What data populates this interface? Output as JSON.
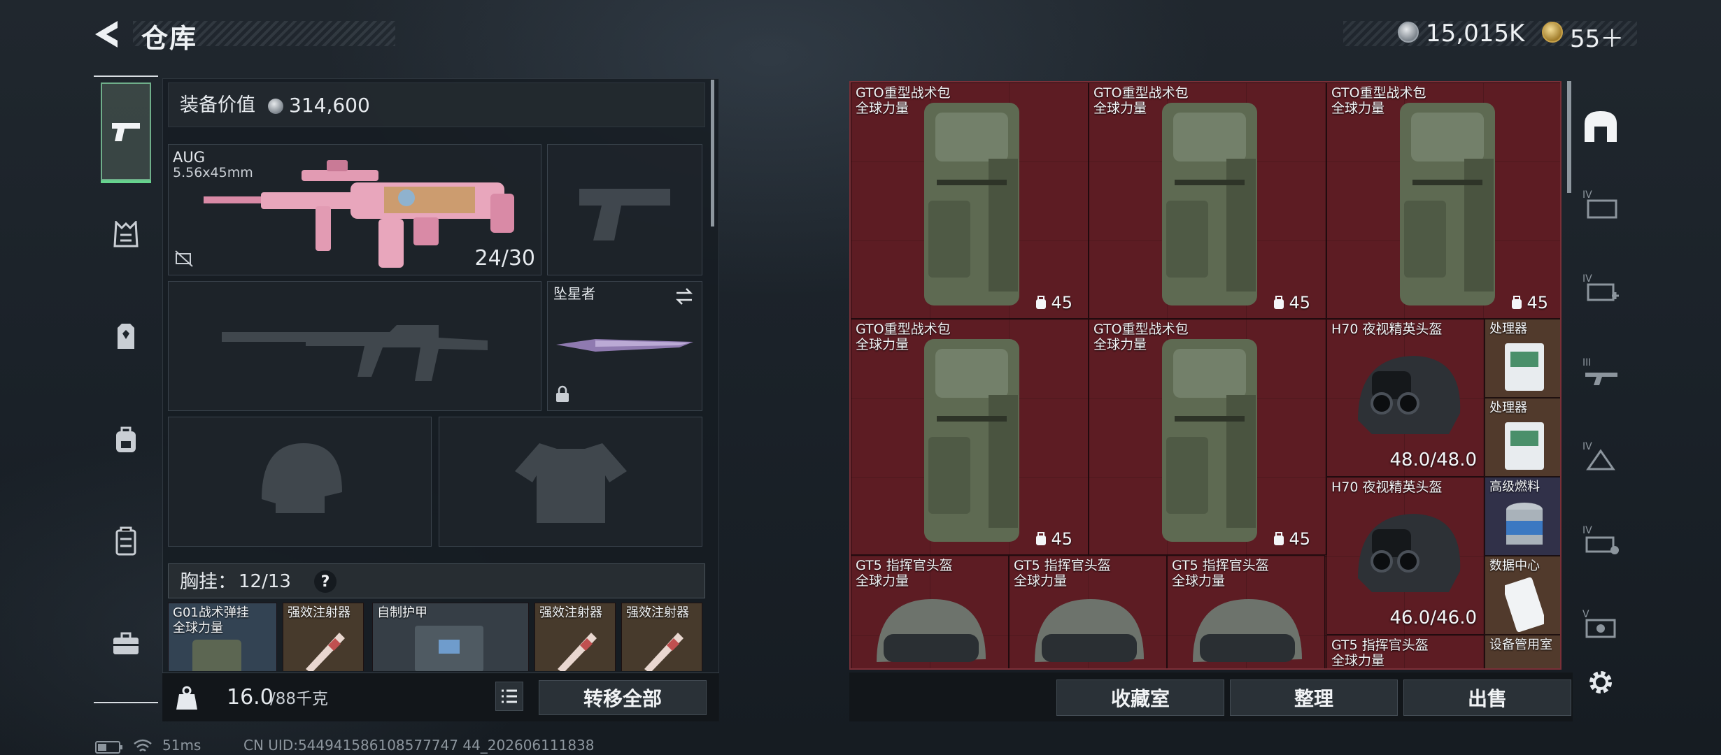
{
  "header": {
    "title": "仓库",
    "currency": [
      {
        "name": "silver-coin",
        "value": "15,015K"
      },
      {
        "name": "gold-coin",
        "value": "55＋"
      }
    ]
  },
  "nav": {
    "items": [
      "pistol-icon",
      "chest-rig-icon",
      "armor-icon",
      "backpack-icon",
      "container-icon",
      "toolbox-icon"
    ],
    "active": "pistol-icon"
  },
  "equipment": {
    "value_label": "装备价值",
    "value": "314,600",
    "primary": {
      "name": "AUG",
      "caliber": "5.56x45mm",
      "ammo": "24/30"
    },
    "melee": {
      "name": "坠星者"
    },
    "chest_rig": {
      "label": "胸挂：",
      "capacity": "12/13",
      "help": "?"
    },
    "rig_items": [
      {
        "name": "G01战术弹挂",
        "sub": "全球力量"
      },
      {
        "name": "强效注射器"
      },
      {
        "name": "自制护甲"
      },
      {
        "name": "强效注射器"
      },
      {
        "name": "强效注射器"
      }
    ],
    "weight_value": "16.0",
    "weight_max": "/88千克",
    "transfer_all": "转移全部"
  },
  "inventory": {
    "items": [
      {
        "name": "GTO重型战术包",
        "sub": "全球力量",
        "capacity": "45"
      },
      {
        "name": "GTO重型战术包",
        "sub": "全球力量",
        "capacity": "45"
      },
      {
        "name": "GTO重型战术包",
        "sub": "全球力量",
        "capacity": "45"
      },
      {
        "name": "GTO重型战术包",
        "sub": "全球力量",
        "capacity": "45"
      },
      {
        "name": "GTO重型战术包",
        "sub": "全球力量",
        "capacity": "45"
      },
      {
        "name": "H70 夜视精英头盔",
        "durability": "48.0/48.0"
      },
      {
        "name": "H70 夜视精英头盔",
        "durability": "46.0/46.0"
      },
      {
        "name": "GT5 指挥官头盔",
        "sub": "全球力量"
      },
      {
        "name": "GT5 指挥官头盔",
        "sub": "全球力量"
      },
      {
        "name": "GT5 指挥官头盔",
        "sub": "全球力量"
      },
      {
        "name": "GT5 指挥官头盔",
        "sub": "全球力量"
      }
    ],
    "small_items": [
      {
        "name": "处理器"
      },
      {
        "name": "处理器"
      },
      {
        "name": "高级燃料"
      },
      {
        "name": "数据中心"
      },
      {
        "name": "设备管用室"
      }
    ]
  },
  "actions": {
    "collection": "收藏室",
    "sort": "整理",
    "sell": "出售"
  },
  "right_tabs": [
    "safehouse-icon",
    "IV",
    "IV",
    "III",
    "IV",
    "IV",
    "V"
  ],
  "footer": {
    "ping": "51ms",
    "uid": "CN UID:544941586108577747 44_202606111838"
  },
  "colors": {
    "inventory_bg": "#5a1b21",
    "accent_green": "#66d48e"
  }
}
